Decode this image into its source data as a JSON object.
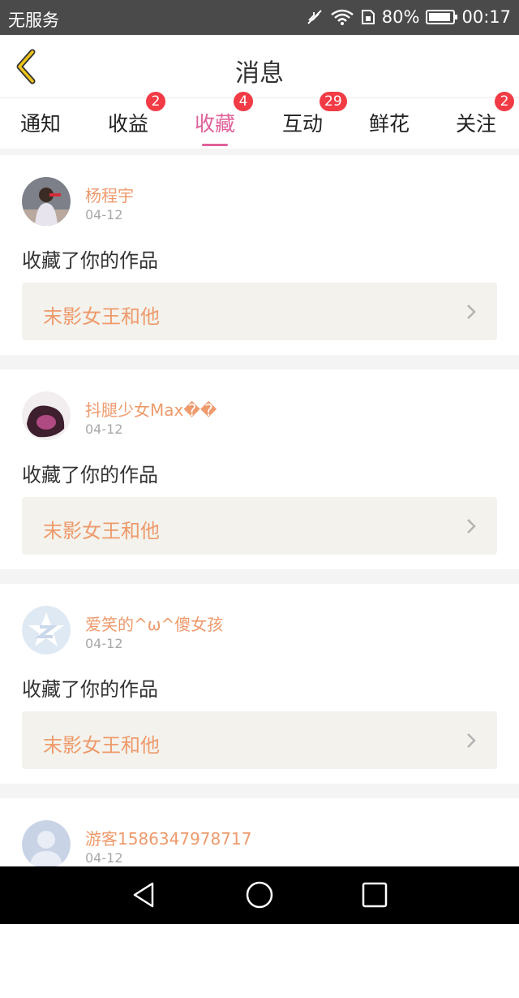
{
  "status_bar": {
    "carrier": "无服务",
    "battery": "80%",
    "time": "00:17"
  },
  "header": {
    "title": "消息"
  },
  "tabs": [
    {
      "label": "通知",
      "badge": ""
    },
    {
      "label": "收益",
      "badge": "2"
    },
    {
      "label": "收藏",
      "badge": "4"
    },
    {
      "label": "互动",
      "badge": "29"
    },
    {
      "label": "鲜花",
      "badge": ""
    },
    {
      "label": "关注",
      "badge": "2"
    }
  ],
  "active_tab": "收藏",
  "items": [
    {
      "user": "杨程宇",
      "date": "04-12",
      "message": "收藏了你的作品",
      "work": "末影女王和他"
    },
    {
      "user": "抖腿少女Max��",
      "date": "04-12",
      "message": "收藏了你的作品",
      "work": "末影女王和他"
    },
    {
      "user": "爱笑的^ω^傻女孩",
      "date": "04-12",
      "message": "收藏了你的作品",
      "work": "末影女王和他"
    },
    {
      "user": "游客1586347978717",
      "date": "04-12",
      "message": "",
      "work": ""
    }
  ],
  "colors": {
    "accent": "#e0609a",
    "name": "#ee9a6c",
    "badge": "#f23b45",
    "back_arrow": "#f0c419"
  }
}
